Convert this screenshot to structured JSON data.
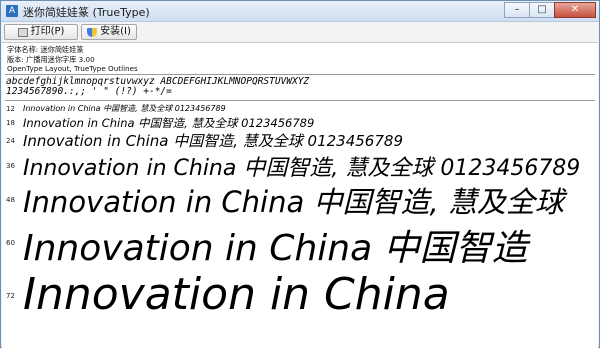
{
  "window": {
    "title": "迷你简娃娃篆 (TrueType)",
    "controls": {
      "minimize": "–",
      "maximize": "□",
      "close": "✕"
    }
  },
  "toolbar": {
    "print_label": "打印(P)",
    "install_label": "安装(I)"
  },
  "info": {
    "font_name_line": "字体名称: 迷你简娃娃篆",
    "version_line": "版本: 广播用迷你字库 3.00",
    "type_line": "OpenType Layout, TrueType Outlines"
  },
  "charset": {
    "line1": "abcdefghijklmnopqrstuvwxyz ABCDEFGHIJKLMNOPQRSTUVWXYZ",
    "line2": "1234567890.:,; ' \" (!?) +-*/="
  },
  "samples": [
    {
      "size": "12",
      "text": "Innovation in China 中国智造, 慧及全球 0123456789"
    },
    {
      "size": "18",
      "text": "Innovation in China 中国智造, 慧及全球 0123456789"
    },
    {
      "size": "24",
      "text": "Innovation in China 中国智造, 慧及全球 0123456789"
    },
    {
      "size": "36",
      "text": "Innovation in China 中国智造, 慧及全球 0123456789"
    },
    {
      "size": "48",
      "text": "Innovation in China 中国智造, 慧及全球"
    },
    {
      "size": "60",
      "text": "Innovation in China 中国智造"
    },
    {
      "size": "72",
      "text": "Innovation in China"
    }
  ]
}
